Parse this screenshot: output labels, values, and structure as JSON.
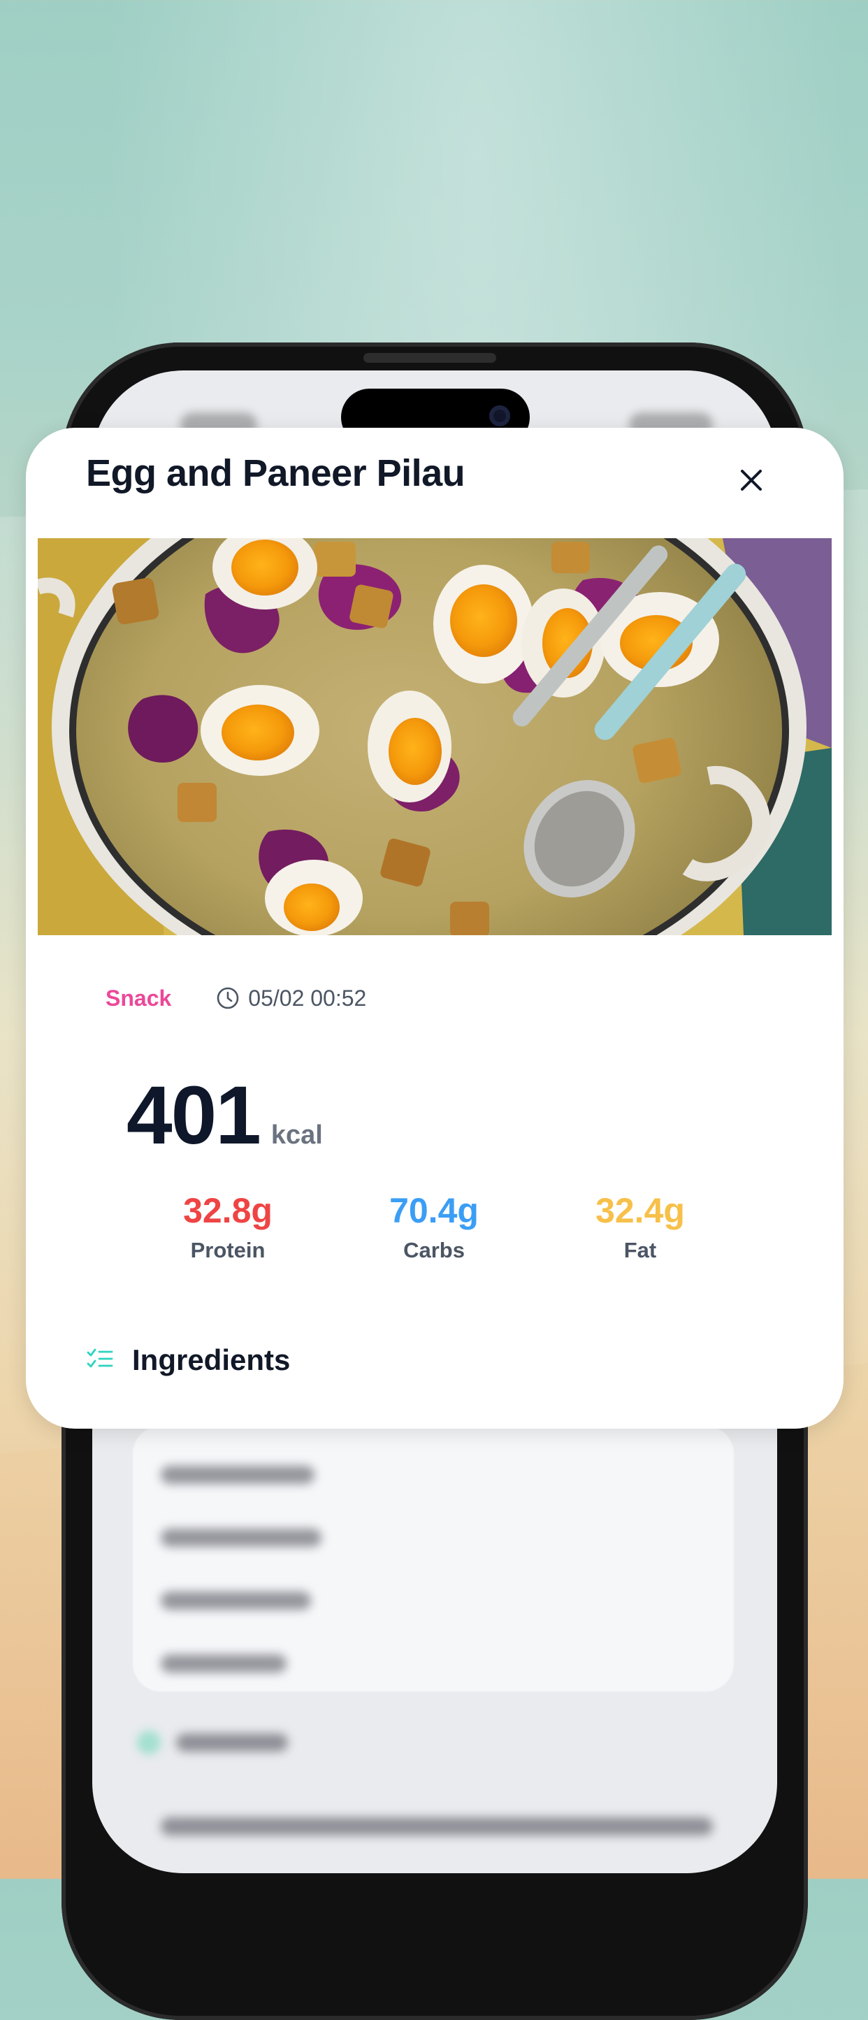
{
  "meal": {
    "title": "Egg and Paneer Pilau",
    "category": "Snack",
    "datetime": "05/02 00:52",
    "calories": "401",
    "calories_unit": "kcal"
  },
  "macros": [
    {
      "value": "32.8g",
      "label": "Protein",
      "color": "#ef4444"
    },
    {
      "value": "70.4g",
      "label": "Carbs",
      "color": "#3b9ef5"
    },
    {
      "value": "32.4g",
      "label": "Fat",
      "color": "#f7c04a"
    }
  ],
  "sections": {
    "ingredients_title": "Ingredients"
  },
  "icons": {
    "close": "close-icon",
    "clock": "clock-icon",
    "ingredients": "checklist-icon"
  },
  "colors": {
    "snack": "#ec4899",
    "accent": "#2dd4bf"
  }
}
